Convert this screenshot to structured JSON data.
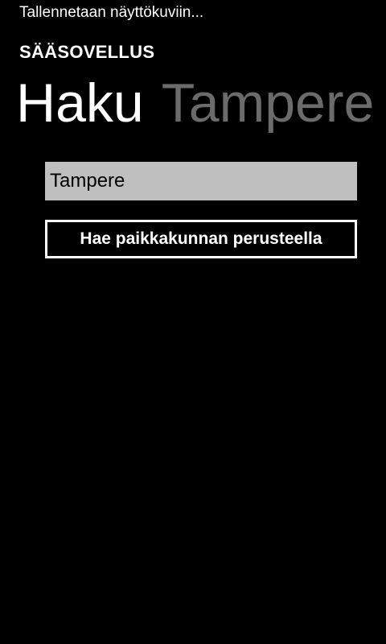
{
  "status": {
    "text": "Tallennetaan näyttökuviin..."
  },
  "app": {
    "title": "SÄÄSOVELLUS"
  },
  "pivot": {
    "items": [
      {
        "label": "Haku",
        "active": true
      },
      {
        "label": "Tampere",
        "active": false
      }
    ]
  },
  "search": {
    "value": "Tampere",
    "button_label": "Hae paikkakunnan perusteella"
  },
  "colors": {
    "background": "#000000",
    "text": "#ffffff",
    "inactive_header": "#6b6b6b",
    "textbox_background": "#bfbfbf"
  }
}
